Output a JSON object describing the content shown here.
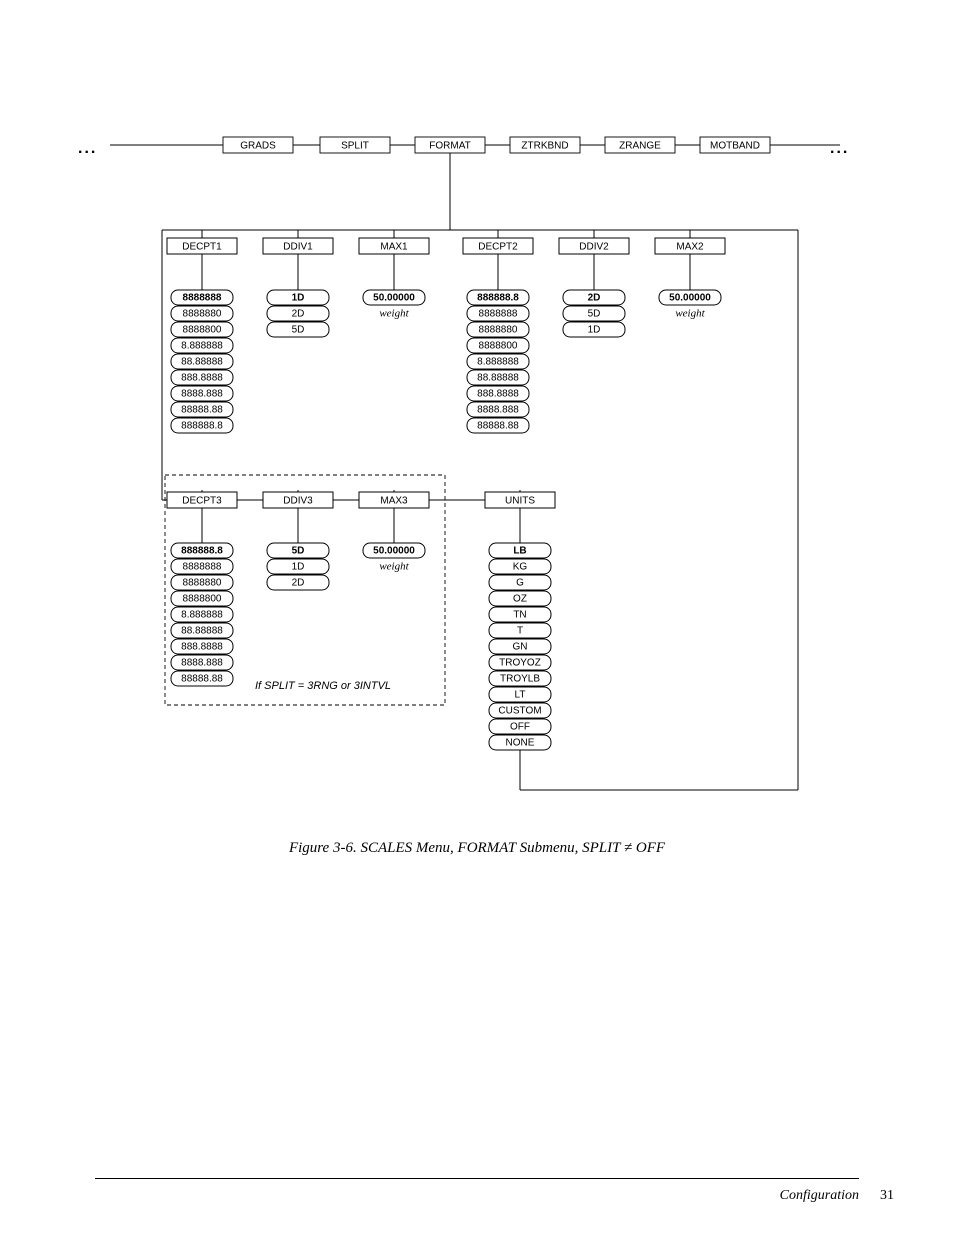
{
  "topRow": {
    "grads": "GRADS",
    "split": "SPLIT",
    "format": "FORMAT",
    "ztrkbnd": "ZTRKBND",
    "zrange": "ZRANGE",
    "motband": "MOTBAND"
  },
  "row2": {
    "decpt1": "DECPT1",
    "ddiv1": "DDIV1",
    "max1": "MAX1",
    "decpt2": "DECPT2",
    "ddiv2": "DDIV2",
    "max2": "MAX2"
  },
  "decpt1_opts": [
    "8888888",
    "8888880",
    "8888800",
    "8.888888",
    "88.88888",
    "888.8888",
    "8888.888",
    "88888.88",
    "888888.8"
  ],
  "ddiv1_opts": [
    "1D",
    "2D",
    "5D"
  ],
  "max1": {
    "value": "50.00000",
    "label": "weight"
  },
  "decpt2_opts": [
    "888888.8",
    "8888888",
    "8888880",
    "8888800",
    "8.888888",
    "88.88888",
    "888.8888",
    "8888.888",
    "88888.88"
  ],
  "ddiv2_opts": [
    "2D",
    "5D",
    "1D"
  ],
  "max2": {
    "value": "50.00000",
    "label": "weight"
  },
  "row3": {
    "decpt3": "DECPT3",
    "ddiv3": "DDIV3",
    "max3": "MAX3",
    "units": "UNITS"
  },
  "decpt3_opts": [
    "888888.8",
    "8888888",
    "8888880",
    "8888800",
    "8.888888",
    "88.88888",
    "888.8888",
    "8888.888",
    "88888.88"
  ],
  "ddiv3_opts": [
    "5D",
    "1D",
    "2D"
  ],
  "max3": {
    "value": "50.00000",
    "label": "weight"
  },
  "units_opts": [
    "LB",
    "KG",
    "G",
    "OZ",
    "TN",
    "T",
    "GN",
    "TROYOZ",
    "TROYLB",
    "LT",
    "CUSTOM",
    "OFF",
    "NONE"
  ],
  "split_note": "If SPLIT = 3RNG or 3INTVL",
  "caption": "Figure 3-6. SCALES Menu, FORMAT Submenu, SPLIT ≠ OFF",
  "footer_section": "Configuration",
  "footer_page": "31",
  "ellipsis": "..."
}
